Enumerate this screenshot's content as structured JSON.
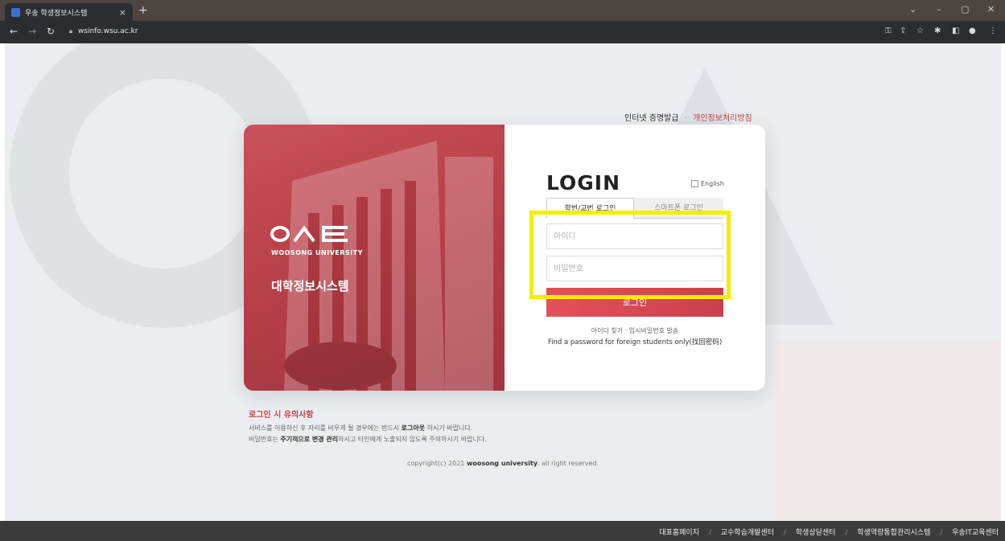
{
  "browser": {
    "tab_title": "우송 학생정보시스템",
    "tab_close": "×",
    "new_tab": "+",
    "url": "wsinfo.wsu.ac.kr",
    "window_controls": {
      "dropdown": "⌄",
      "minimize": "–",
      "maximize": "▢",
      "close": "✕"
    }
  },
  "page": {
    "top_links": {
      "certificate": "인터넷 증명발급",
      "separator": "·",
      "privacy": "개인정보처리방침"
    },
    "brand": {
      "logo": "O∧ㄷ",
      "university": "WOOSONG UNIVERSITY",
      "system": "대학정보시스템"
    },
    "login": {
      "title": "LOGIN",
      "english_label": "English",
      "tabs": [
        "학번/교번 로그인",
        "스마트폰 로그인"
      ],
      "id_placeholder": "아이디",
      "pw_placeholder": "비밀번호",
      "button": "로그인",
      "find_links": "아이디 찾기 · 임시비밀번호 발송",
      "foreign_link": "Find a password for foreign students only(找回密码)"
    },
    "notice": {
      "title": "로그인 시 유의사항",
      "line1_pre": "서비스를 이용하신 후 자리를 비우게 될 경우에는 반드시 ",
      "line1_bold": "로그아웃",
      "line1_post": " 하시기 바랍니다.",
      "line2_pre": "비밀번호는 ",
      "line2_bold": "주기적으로 변경 관리",
      "line2_post": "하시고 타인에게 노출되지 않도록 주의하시기 바랍니다."
    },
    "copyright": {
      "pre": "copyright(c) 2021 ",
      "bold": "woosong university",
      "post": ". all right reserved."
    }
  },
  "footer": {
    "links": [
      "대표홈페이지",
      "교수학습개발센터",
      "학생상담센터",
      "학생역량통합관리시스템",
      "우송IT교육센터"
    ],
    "separator": "/"
  },
  "colors": {
    "brand_red": "#c4434c",
    "highlight": "#f4ee00"
  }
}
